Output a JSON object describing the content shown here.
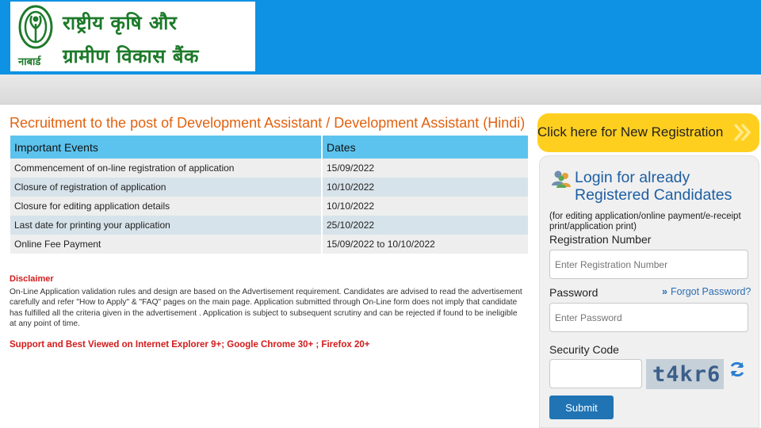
{
  "header": {
    "logo_hindi_line1": "राष्ट्रीय कृषि और",
    "logo_hindi_line2": "ग्रामीण विकास बैंक",
    "logo_abbrev": "नाबार्ड"
  },
  "main": {
    "title": "Recruitment to the post of Development Assistant / Development Assistant (Hindi)",
    "table": {
      "headers": [
        "Important Events",
        "Dates"
      ],
      "rows": [
        [
          "Commencement of on-line registration of application",
          "15/09/2022"
        ],
        [
          "Closure of registration of application",
          "10/10/2022"
        ],
        [
          "Closure for editing application details",
          "10/10/2022"
        ],
        [
          "Last date for printing your application",
          "25/10/2022"
        ],
        [
          "Online Fee Payment",
          "15/09/2022 to 10/10/2022"
        ]
      ]
    },
    "disclaimer_title": "Disclaimer",
    "disclaimer_text": "On-Line Application validation rules and design are based on the Advertisement requirement. Candidates are advised to read the advertisement carefully and refer \"How to Apply\" & \"FAQ\" pages on the main page. Application submitted through On-Line form does not imply that candidate has fulfilled all the criteria given in the advertisement . Application is subject to subsequent scrutiny and can be rejected if found to be ineligible at any point of time.",
    "support_note": "Support and Best Viewed on Internet Explorer 9+; Google Chrome 30+ ; Firefox 20+"
  },
  "sidebar": {
    "new_registration_label": "Click here for New Registration",
    "login_title_line1": "Login for already",
    "login_title_line2": "Registered Candidates",
    "login_note": "(for editing application/online payment/e-receipt print/application print)",
    "registration_label": "Registration Number",
    "registration_placeholder": "Enter Registration Number",
    "password_label": "Password",
    "password_placeholder": "Enter Password",
    "forgot_password": "Forgot Password?",
    "security_label": "Security Code",
    "captcha_text": "t4kr6",
    "submit_label": "Submit"
  },
  "colors": {
    "header_blue": "#0e92e3",
    "title_orange": "#e2620f",
    "table_header": "#5cc3ee",
    "new_reg_yellow": "#ffcf1f",
    "disclaimer_red": "#d21b1b",
    "submit_blue": "#2074b4"
  },
  "icons": [
    "nabard-logo-icon",
    "users-icon",
    "double-chevron-icon",
    "refresh-icon"
  ]
}
